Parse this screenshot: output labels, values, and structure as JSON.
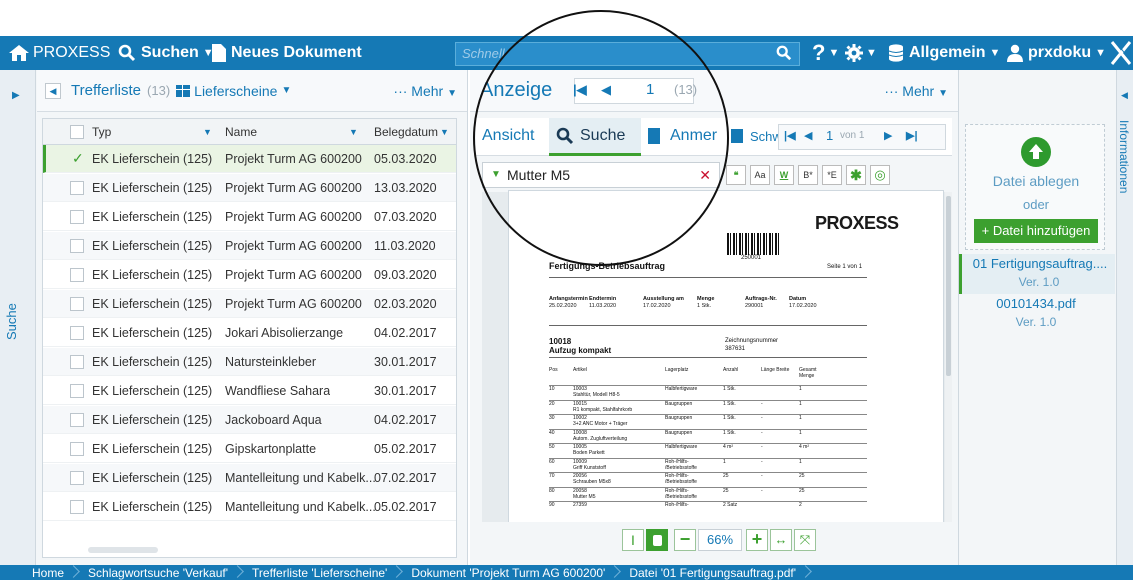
{
  "topbar": {
    "brand": "PROXESS",
    "search_label": "Suchen",
    "new_doc_label": "Neues Dokument",
    "search_placeholder": "Schnell",
    "archive_label": "Allgemein",
    "user_label": "prxdoku",
    "colors": {
      "bar": "#1579b5",
      "accent_green": "#3ca02f"
    }
  },
  "left": {
    "sidebar_label": "Suche",
    "title": "Trefferliste",
    "count": "(13)",
    "view_label": "Lieferscheine",
    "more_label": "Mehr",
    "columns": [
      "Typ",
      "Name",
      "Belegdatum"
    ],
    "rows": [
      {
        "typ": "EK Lieferschein (125)",
        "name": "Projekt Turm AG 600200",
        "date": "05.03.2020",
        "selected": true
      },
      {
        "typ": "EK Lieferschein (125)",
        "name": "Projekt Turm AG 600200",
        "date": "13.03.2020"
      },
      {
        "typ": "EK Lieferschein (125)",
        "name": "Projekt Turm AG 600200",
        "date": "07.03.2020"
      },
      {
        "typ": "EK Lieferschein (125)",
        "name": "Projekt Turm AG 600200",
        "date": "11.03.2020"
      },
      {
        "typ": "EK Lieferschein (125)",
        "name": "Projekt Turm AG 600200",
        "date": "09.03.2020"
      },
      {
        "typ": "EK Lieferschein (125)",
        "name": "Projekt Turm AG 600200",
        "date": "02.03.2020"
      },
      {
        "typ": "EK Lieferschein (125)",
        "name": "Jokari Abisolierzange",
        "date": "04.02.2017"
      },
      {
        "typ": "EK Lieferschein (125)",
        "name": "Natursteinkleber",
        "date": "30.01.2017"
      },
      {
        "typ": "EK Lieferschein (125)",
        "name": "Wandfliese Sahara",
        "date": "30.01.2017"
      },
      {
        "typ": "EK Lieferschein (125)",
        "name": "Jackoboard Aqua",
        "date": "04.02.2017"
      },
      {
        "typ": "EK Lieferschein (125)",
        "name": "Gipskartonplatte",
        "date": "05.02.2017"
      },
      {
        "typ": "EK Lieferschein (125)",
        "name": "Mantelleitung und Kabelk...",
        "date": "07.02.2017"
      },
      {
        "typ": "EK Lieferschein (125)",
        "name": "Mantelleitung und Kabelk...",
        "date": "05.02.2017"
      }
    ]
  },
  "center": {
    "title": "Anzeige",
    "page": "1",
    "page_count": "(13)",
    "more_label": "Mehr",
    "tabs": [
      "Ansicht",
      "Suche",
      "Anmer",
      "Schw"
    ],
    "page_nav_current": "1",
    "page_nav_of": "von 1",
    "search_term": "Mutter M5",
    "tool_labels": [
      "Aa",
      "W",
      "B*",
      "*E"
    ],
    "zoom": "66%"
  },
  "document": {
    "logo": "PROXESS",
    "barcode_number": "250001",
    "title": "Fertigungs-Betriebsauftrag",
    "page_label": "Seite 1 von 1",
    "header_labels": [
      "Anfangstermin",
      "Endtermin",
      "Ausstellung am",
      "Menge",
      "Auftrags-Nr.",
      "Datum"
    ],
    "header_values": [
      "25.02.2020",
      "11.03.2020",
      "17.02.2020",
      "1 Stk.",
      "290001",
      "17.02.2020"
    ],
    "article_no": "10018",
    "article_name": "Aufzug kompakt",
    "drawing_label": "Zeichnungsnummer",
    "drawing_no": "387631",
    "table_headers": [
      "Pos",
      "Artikel",
      "Lagerplatz",
      "Anzahl",
      "Länge Breite",
      "Gesamt Menge"
    ],
    "table_rows": [
      {
        "pos": "10",
        "art": "10003",
        "desc": "Stahltür, Modell H8-5",
        "lager": "Halbfertigware",
        "anz": "1 Stk.",
        "lb": "",
        "ges": "1"
      },
      {
        "pos": "20",
        "art": "10015",
        "desc": "R1 kompakt, Stahlfahrkorb",
        "lager": "Baugruppen",
        "anz": "1 Stk.",
        "lb": "-",
        "ges": "1"
      },
      {
        "pos": "30",
        "art": "10002",
        "desc": "3+2 ANC Motor + Träger",
        "lager": "Baugruppen",
        "anz": "1 Stk.",
        "lb": "-",
        "ges": "1"
      },
      {
        "pos": "40",
        "art": "10008",
        "desc": "Autom. Zugluftverteilung",
        "lager": "Baugruppen",
        "anz": "1 Stk.",
        "lb": "-",
        "ges": "1"
      },
      {
        "pos": "50",
        "art": "10005",
        "desc": "Boden Parkett",
        "lager": "Halbfertigware",
        "anz": "4 m²",
        "lb": "-",
        "ges": "4 m²"
      },
      {
        "pos": "60",
        "art": "10009",
        "desc": "Griff Kunststoff",
        "lager": "Roh-/Hilfs- /Betriebsstoffe",
        "anz": "1",
        "lb": "-",
        "ges": "1"
      },
      {
        "pos": "70",
        "art": "20056",
        "desc": "Schrauben M5x8",
        "lager": "Roh-/Hilfs- /Betriebsstoffe",
        "anz": "25",
        "lb": "-",
        "ges": "25"
      },
      {
        "pos": "80",
        "art": "20058",
        "desc": "Mutter M5",
        "lager": "Roh-/Hilfs- /Betriebsstoffe",
        "anz": "25",
        "lb": "-",
        "ges": "25"
      },
      {
        "pos": "90",
        "art": "27359",
        "desc": "",
        "lager": "Roh-/Hilfs-",
        "anz": "2 Satz",
        "lb": "",
        "ges": "2"
      }
    ]
  },
  "right": {
    "drop_label": "Datei ablegen",
    "or_label": "oder",
    "add_button": "+ Datei hinzufügen",
    "files": [
      {
        "name": "01 Fertigungsauftrag....",
        "version": "Ver. 1.0",
        "selected": true
      },
      {
        "name": "00101434.pdf",
        "version": "Ver. 1.0"
      }
    ],
    "info_label": "Informationen"
  },
  "breadcrumb": [
    "Home",
    "Schlagwortsuche 'Verkauf'",
    "Trefferliste 'Lieferscheine'",
    "Dokument 'Projekt Turm AG 600200'",
    "Datei '01 Fertigungsauftrag.pdf'"
  ]
}
